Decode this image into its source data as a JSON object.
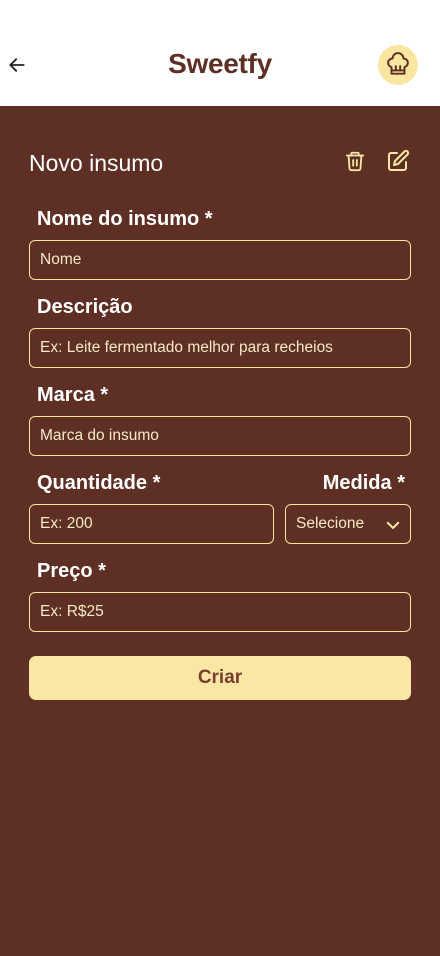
{
  "header": {
    "title": "Sweetfy",
    "back_icon": "arrow-left-icon",
    "avatar_icon": "chef-hat-icon"
  },
  "form": {
    "title": "Novo insumo",
    "delete_icon": "trash-icon",
    "edit_icon": "edit-icon",
    "fields": {
      "name": {
        "label": "Nome do insumo *",
        "placeholder": "Nome"
      },
      "description": {
        "label": "Descrição",
        "placeholder": "Ex: Leite fermentado melhor para recheios"
      },
      "brand": {
        "label": "Marca *",
        "placeholder": "Marca do insumo"
      },
      "quantity": {
        "label": "Quantidade *",
        "placeholder": "Ex: 200"
      },
      "measure": {
        "label": "Medida *",
        "selected": "Selecione"
      },
      "price": {
        "label": "Preço *",
        "placeholder": "Ex: R$25"
      }
    },
    "submit_label": "Criar"
  },
  "colors": {
    "brand_brown": "#5e2f24",
    "accent_yellow": "#f9e6a1",
    "button_text": "#7a3e2e"
  }
}
